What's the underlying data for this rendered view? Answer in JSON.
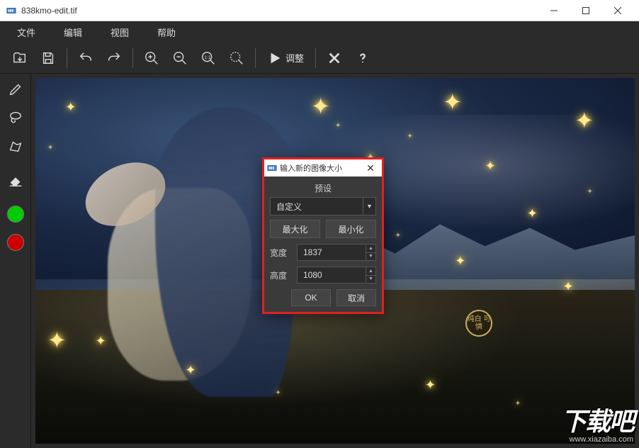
{
  "titlebar": {
    "title": "838kmo-edit.tif"
  },
  "menu": {
    "file": "文件",
    "edit": "编辑",
    "view": "视图",
    "help": "帮助"
  },
  "toolbar": {
    "adjust": "调整"
  },
  "sidebar": {
    "color1": "#00cc00",
    "color2": "#cc0000"
  },
  "dialog": {
    "title": "输入新的图像大小",
    "preset_label": "预设",
    "preset_value": "自定义",
    "maximize": "最大化",
    "minimize": "最小化",
    "width_label": "宽度",
    "width_value": "1837",
    "height_label": "高度",
    "height_value": "1080",
    "ok": "OK",
    "cancel": "取消"
  },
  "badge": {
    "text": "纯白\n可憐"
  },
  "watermark": {
    "logo": "下载吧",
    "url": "www.xiazaiba.com"
  }
}
